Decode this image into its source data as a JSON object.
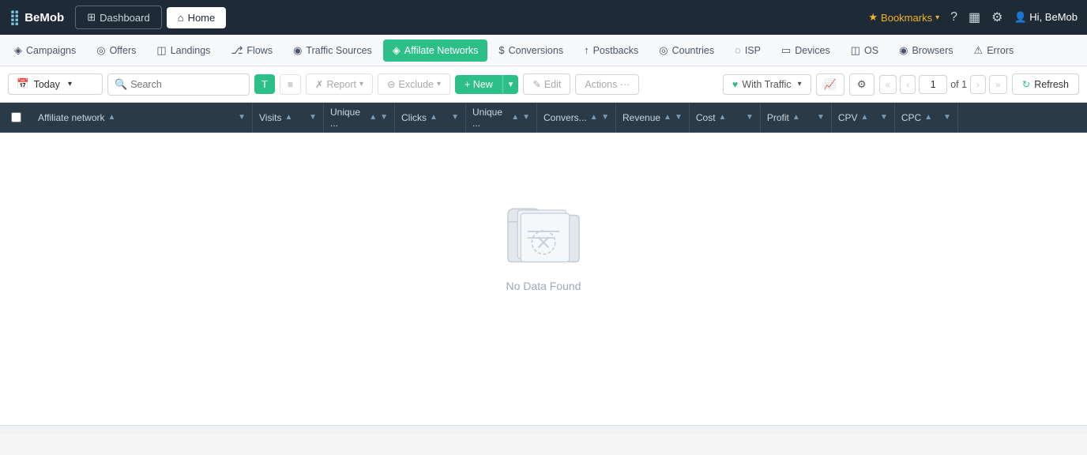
{
  "brand": {
    "logo_text": "BeMob",
    "logo_icon": "⣿"
  },
  "topnav": {
    "tabs": [
      {
        "id": "dashboard",
        "label": "Dashboard",
        "icon": "⊞",
        "active": false
      },
      {
        "id": "home",
        "label": "Home",
        "icon": "⌂",
        "active": true
      }
    ]
  },
  "topbar_right": {
    "bookmarks_label": "Bookmarks",
    "help_icon": "?",
    "notifications_icon": "▦",
    "settings_icon": "⚙",
    "hi_label": "Hi, BeMob"
  },
  "subnav": {
    "items": [
      {
        "id": "campaigns",
        "label": "Campaigns",
        "icon": "◈"
      },
      {
        "id": "offers",
        "label": "Offers",
        "icon": "◎"
      },
      {
        "id": "landings",
        "label": "Landings",
        "icon": "◫"
      },
      {
        "id": "flows",
        "label": "Flows",
        "icon": "⎇"
      },
      {
        "id": "traffic-sources",
        "label": "Traffic Sources",
        "icon": "◉"
      },
      {
        "id": "affiliate-networks",
        "label": "Affilate Networks",
        "icon": "◈",
        "active": true
      },
      {
        "id": "conversions",
        "label": "Conversions",
        "icon": "$"
      },
      {
        "id": "postbacks",
        "label": "Postbacks",
        "icon": "↑"
      },
      {
        "id": "countries",
        "label": "Countries",
        "icon": "◎"
      },
      {
        "id": "isp",
        "label": "ISP",
        "icon": "◌"
      },
      {
        "id": "devices",
        "label": "Devices",
        "icon": "▭"
      },
      {
        "id": "os",
        "label": "OS",
        "icon": "◫"
      },
      {
        "id": "browsers",
        "label": "Browsers",
        "icon": "◉"
      },
      {
        "id": "errors",
        "label": "Errors",
        "icon": "⚠"
      }
    ]
  },
  "toolbar": {
    "date_label": "Today",
    "search_placeholder": "Search",
    "report_label": "Report",
    "exclude_label": "Exclude",
    "new_label": "+ New",
    "edit_label": "Edit",
    "actions_label": "Actions ···",
    "traffic_label": "With Traffic",
    "refresh_label": "Refresh",
    "page_current": "1",
    "page_of": "of 1"
  },
  "table": {
    "columns": [
      {
        "id": "affiliate-network",
        "label": "Affiliate network"
      },
      {
        "id": "visits",
        "label": "Visits"
      },
      {
        "id": "unique-visits",
        "label": "Unique ..."
      },
      {
        "id": "clicks",
        "label": "Clicks"
      },
      {
        "id": "unique-clicks",
        "label": "Unique ..."
      },
      {
        "id": "conversions",
        "label": "Convers..."
      },
      {
        "id": "revenue",
        "label": "Revenue"
      },
      {
        "id": "cost",
        "label": "Cost"
      },
      {
        "id": "profit",
        "label": "Profit"
      },
      {
        "id": "cpv",
        "label": "CPV"
      },
      {
        "id": "cpc",
        "label": "CPC"
      }
    ]
  },
  "empty_state": {
    "message": "No Data Found"
  }
}
